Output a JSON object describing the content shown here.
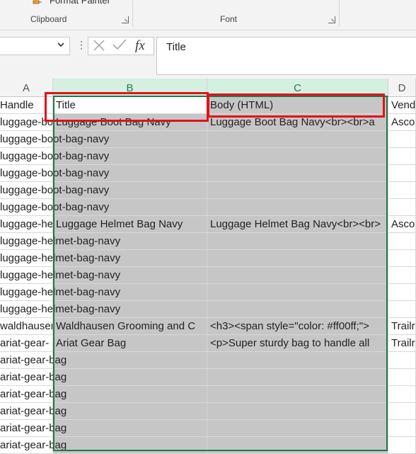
{
  "ribbon": {
    "painter_label": "Format Painter",
    "groups": [
      {
        "label": "Clipboard"
      },
      {
        "label": "Font"
      }
    ]
  },
  "formula_bar": {
    "name_box": "",
    "cancel_icon": "close-icon",
    "enter_icon": "check-icon",
    "fx_label": "fx",
    "content": "Title"
  },
  "columns": [
    {
      "letter": "A"
    },
    {
      "letter": "B"
    },
    {
      "letter": "C"
    },
    {
      "letter": "D"
    }
  ],
  "header_row": {
    "a": "Handle",
    "b": "Title",
    "c": "Body (HTML)",
    "d": "Vend"
  },
  "rows": [
    {
      "a": "luggage-boot-bag-navy",
      "b": "Luggage Boot Bag Navy",
      "c": "Luggage Boot Bag Navy<br><br>a",
      "d": "Asco"
    },
    {
      "a": "luggage-boot-bag-navy",
      "b": "",
      "c": "",
      "d": ""
    },
    {
      "a": "luggage-boot-bag-navy",
      "b": "",
      "c": "",
      "d": ""
    },
    {
      "a": "luggage-boot-bag-navy",
      "b": "",
      "c": "",
      "d": ""
    },
    {
      "a": "luggage-boot-bag-navy",
      "b": "",
      "c": "",
      "d": ""
    },
    {
      "a": "luggage-boot-bag-navy",
      "b": "",
      "c": "",
      "d": ""
    },
    {
      "a": "luggage-helmet-bag-navy",
      "b": "Luggage Helmet Bag Navy",
      "c": "Luggage Helmet Bag Navy<br><br>",
      "d": "Asco"
    },
    {
      "a": "luggage-helmet-bag-navy",
      "b": "",
      "c": "",
      "d": ""
    },
    {
      "a": "luggage-helmet-bag-navy",
      "b": "",
      "c": "",
      "d": ""
    },
    {
      "a": "luggage-helmet-bag-navy",
      "b": "",
      "c": "",
      "d": ""
    },
    {
      "a": "luggage-helmet-bag-navy",
      "b": "",
      "c": "",
      "d": ""
    },
    {
      "a": "luggage-helmet-bag-navy",
      "b": "",
      "c": "",
      "d": ""
    },
    {
      "a": "waldhausen",
      "b": "Waldhausen Grooming and C",
      "c": "<h3><span style=\"color: #ff00ff;\">",
      "d": "Trailr"
    },
    {
      "a": "ariat-gear-",
      "b": "Ariat Gear Bag",
      "c": "<p>Super sturdy bag to handle all",
      "d": "Trailr"
    },
    {
      "a": "ariat-gear-bag",
      "b": "",
      "c": "",
      "d": ""
    },
    {
      "a": "ariat-gear-bag",
      "b": "",
      "c": "",
      "d": ""
    },
    {
      "a": "ariat-gear-bag",
      "b": "",
      "c": "",
      "d": ""
    },
    {
      "a": "ariat-gear-bag",
      "b": "",
      "c": "",
      "d": ""
    },
    {
      "a": "ariat-gear-bag",
      "b": "",
      "c": "",
      "d": ""
    },
    {
      "a": "ariat-gear-bag",
      "b": "",
      "c": "",
      "d": ""
    }
  ],
  "colors": {
    "selection_border": "#1d7a45",
    "highlight": "#e5101a",
    "selected_fill": "#c6c6c6"
  }
}
